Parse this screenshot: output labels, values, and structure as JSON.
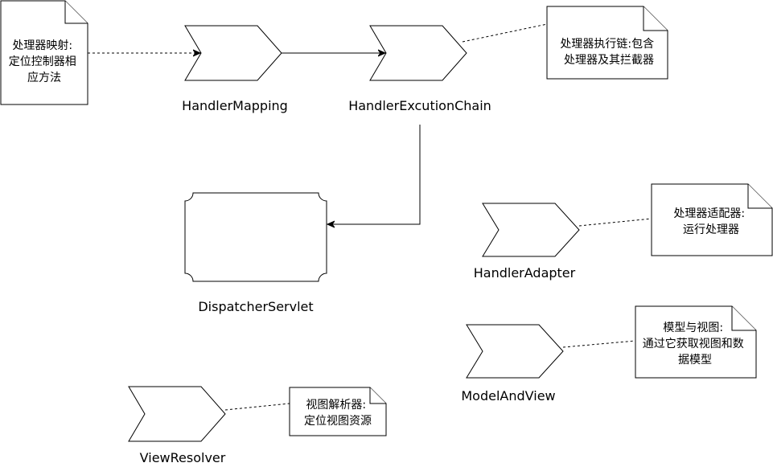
{
  "nodes": {
    "handler_mapping": {
      "label": "HandlerMapping"
    },
    "handler_exec_chain": {
      "label": "HandlerExcutionChain"
    },
    "dispatcher_servlet": {
      "label": "DispatcherServlet"
    },
    "handler_adapter": {
      "label": "HandlerAdapter"
    },
    "model_and_view": {
      "label": "ModelAndView"
    },
    "view_resolver": {
      "label": "ViewResolver"
    }
  },
  "notes": {
    "mapping_note": {
      "lines": [
        "处理器映射:",
        "定位控制器相",
        "应方法"
      ]
    },
    "chain_note": {
      "lines": [
        "处理器执行链:包含",
        "处理器及其拦截器"
      ]
    },
    "adapter_note": {
      "lines": [
        "处理器适配器:",
        "运行处理器"
      ]
    },
    "mav_note": {
      "lines": [
        "模型与视图:",
        "通过它获取视图和数",
        "据模型"
      ]
    },
    "resolver_note": {
      "lines": [
        "视图解析器:",
        "定位视图资源"
      ]
    }
  },
  "colors": {
    "stroke": "#000000",
    "fill": "#ffffff"
  }
}
